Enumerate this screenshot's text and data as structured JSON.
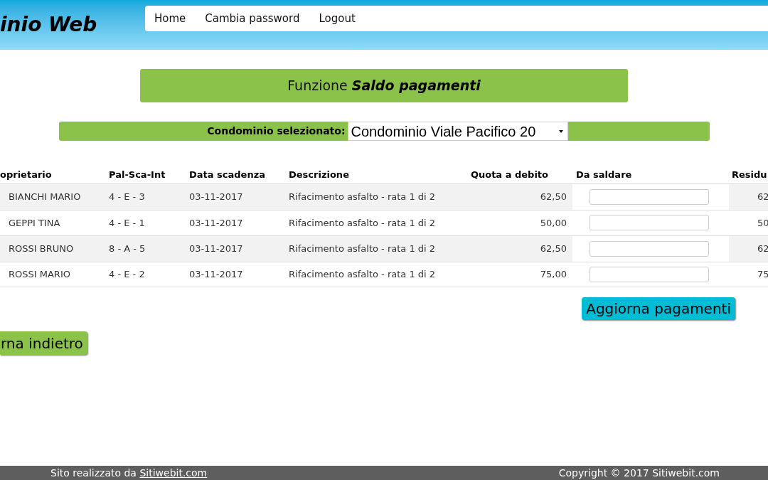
{
  "header": {
    "logo": "inio Web",
    "nav": [
      {
        "label": "Home"
      },
      {
        "label": "Cambia password"
      },
      {
        "label": "Logout"
      }
    ]
  },
  "function_bar": {
    "title": "Funzione **Saldo pagamenti**"
  },
  "condominium_selector": {
    "label": "Condominio selezionato:",
    "value": "Condominio Viale Pacifico 20"
  },
  "table": {
    "columns": [
      "oprietario",
      "Pal-Sca-Int",
      "Data scadenza",
      "Descrizione",
      "Quota a debito",
      "Da saldare",
      "Residu"
    ],
    "rows": [
      {
        "owner": "BIANCHI MARIO",
        "unit": "4 - E - 3",
        "due_date": "03-11-2017",
        "description": "Rifacimento asfalto - rata 1 di 2",
        "amount_due": "62,50",
        "residual": "62"
      },
      {
        "owner": "GEPPI TINA",
        "unit": "4 - E - 1",
        "due_date": "03-11-2017",
        "description": "Rifacimento asfalto - rata 1 di 2",
        "amount_due": "50,00",
        "residual": "50"
      },
      {
        "owner": "ROSSI BRUNO",
        "unit": "8 - A - 5",
        "due_date": "03-11-2017",
        "description": "Rifacimento asfalto - rata 1 di 2",
        "amount_due": "62,50",
        "residual": "62"
      },
      {
        "owner": "ROSSI MARIO",
        "unit": "4 - E - 2",
        "due_date": "03-11-2017",
        "description": "Rifacimento asfalto - rata 1 di 2",
        "amount_due": "75,00",
        "residual": "75"
      }
    ]
  },
  "buttons": {
    "update": "Aggiorna pagamenti",
    "back": "rna indietro"
  },
  "footer": {
    "credit_text": "Sito realizzato da",
    "credit_link": "Sitiwebit.com",
    "copyright": "Copyright © 2017 Sitiwebit.com"
  }
}
